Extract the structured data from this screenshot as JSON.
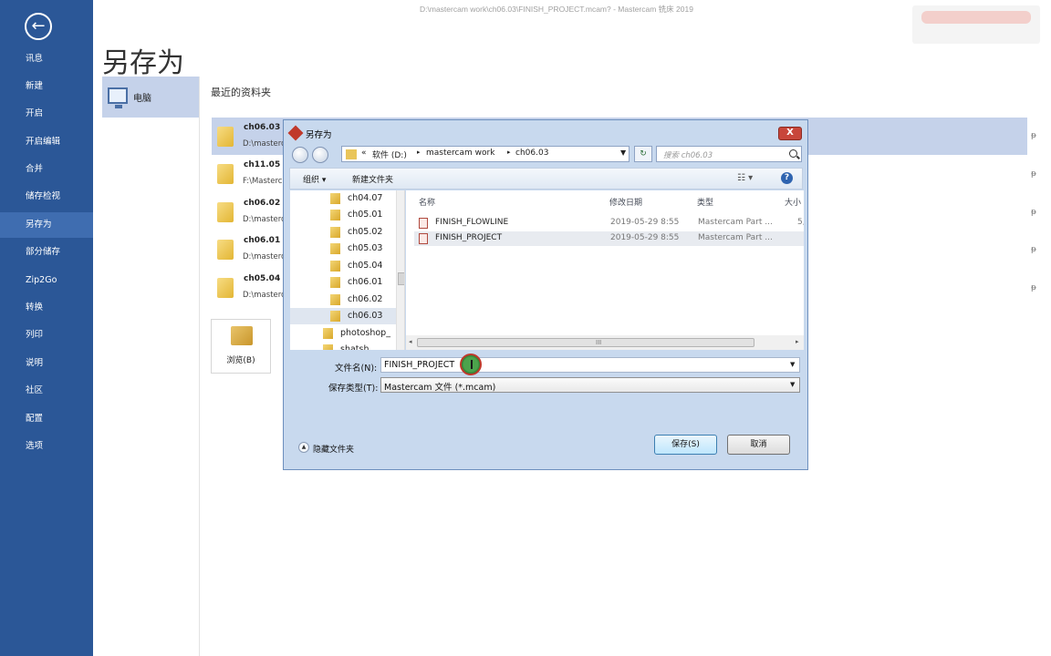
{
  "window": {
    "title": "D:\\mastercam work\\ch06.03\\FINISH_PROJECT.mcam? - Mastercam 铣床 2019"
  },
  "nav": {
    "back_icon": "back-arrow-icon",
    "items": [
      {
        "label": "讯息"
      },
      {
        "label": "新建"
      },
      {
        "label": "开启"
      },
      {
        "label": "开启编辑"
      },
      {
        "label": "合并"
      },
      {
        "label": "储存检视"
      },
      {
        "label": "另存为"
      },
      {
        "label": "部分储存"
      },
      {
        "label": "Zip2Go"
      },
      {
        "label": "转换"
      },
      {
        "label": "列印"
      },
      {
        "label": "说明"
      },
      {
        "label": "社区"
      },
      {
        "label": "配置"
      },
      {
        "label": "选项"
      }
    ],
    "active_index": 6
  },
  "page": {
    "title": "另存为",
    "location_label": "电脑",
    "recent_title": "最近的资料夹",
    "recent": [
      {
        "name": "ch06.03",
        "path": "D:\\masterc"
      },
      {
        "name": "ch11.05",
        "path": "F:\\Masterc"
      },
      {
        "name": "ch06.02",
        "path": "D:\\masterc"
      },
      {
        "name": "ch06.01",
        "path": "D:\\masterc"
      },
      {
        "name": "ch05.04",
        "path": "D:\\masterc"
      }
    ],
    "pin_glyph": "ᵽ",
    "browse_label": "浏览(B)"
  },
  "dialog": {
    "title": "另存为",
    "close_glyph": "X",
    "address": {
      "prefix": "«",
      "segments": [
        "软件 (D:)",
        "mastercam work",
        "ch06.03"
      ],
      "separator": "▸"
    },
    "search_placeholder": "搜索 ch06.03",
    "toolbar": {
      "organize": "组织 ▾",
      "new_folder": "新建文件夹",
      "view_glyph": "☷ ▾",
      "help_glyph": "?"
    },
    "tree": {
      "items": [
        {
          "label": "ch04.07"
        },
        {
          "label": "ch05.01"
        },
        {
          "label": "ch05.02"
        },
        {
          "label": "ch05.03"
        },
        {
          "label": "ch05.04"
        },
        {
          "label": "ch06.01"
        },
        {
          "label": "ch06.02"
        },
        {
          "label": "ch06.03"
        },
        {
          "label": "photoshop_"
        },
        {
          "label": "shatsh"
        }
      ],
      "selected_index": 7
    },
    "columns": {
      "name": "名称",
      "date": "修改日期",
      "type": "类型",
      "size": "大小"
    },
    "files": [
      {
        "name": "FINISH_FLOWLINE",
        "date": "2019-05-29 8:55",
        "type": "Mastercam Part ...",
        "size": "5,"
      },
      {
        "name": "FINISH_PROJECT",
        "date": "2019-05-29 8:55",
        "type": "Mastercam Part ...",
        "size": ""
      }
    ],
    "hscroll_grip": "III",
    "filename_label": "文件名(N):",
    "filename_value": "FINISH_PROJECT",
    "filetype_label": "保存类型(T):",
    "filetype_value": "Mastercam 文件 (*.mcam)",
    "hide_folders_label": "隐藏文件夹",
    "save_label": "保存(S)",
    "cancel_label": "取消"
  }
}
